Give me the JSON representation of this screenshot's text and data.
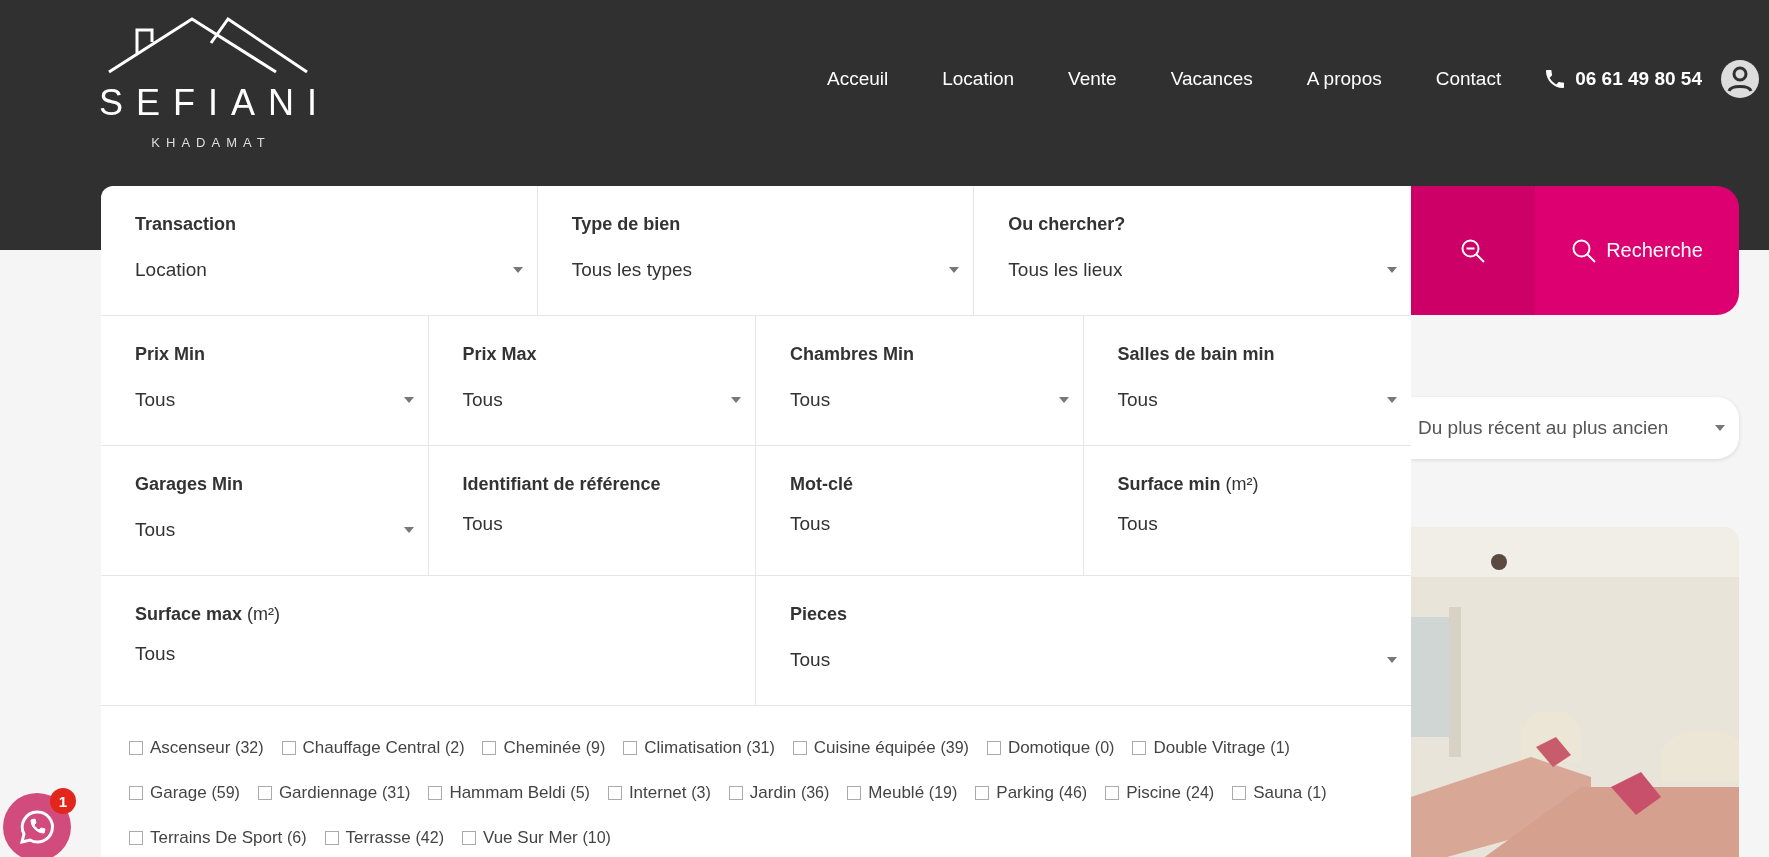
{
  "header": {
    "logo": {
      "name": "SEFIANI",
      "tagline": "KHADAMAT"
    },
    "nav": [
      {
        "label": "Acceuil"
      },
      {
        "label": "Location"
      },
      {
        "label": "Vente"
      },
      {
        "label": "Vacances"
      },
      {
        "label": "A propos"
      },
      {
        "label": "Contact"
      }
    ],
    "phone": "06 61 49 80 54"
  },
  "search": {
    "field_groups": [
      {
        "fields": [
          {
            "kind": "select",
            "label": "Transaction",
            "value": "Location"
          },
          {
            "kind": "select",
            "label": "Type de bien",
            "value": "Tous les types"
          },
          {
            "kind": "select",
            "label": "Ou chercher?",
            "value": "Tous les lieux"
          }
        ]
      },
      {
        "fields": [
          {
            "kind": "select",
            "label": "Prix Min",
            "value": "Tous"
          },
          {
            "kind": "select",
            "label": "Prix Max",
            "value": "Tous"
          },
          {
            "kind": "select",
            "label": "Chambres Min",
            "value": "Tous"
          },
          {
            "kind": "select",
            "label": "Salles de bain min",
            "value": "Tous"
          }
        ]
      },
      {
        "fields": [
          {
            "kind": "select",
            "label": "Garages Min",
            "value": "Tous"
          },
          {
            "kind": "input",
            "label": "Identifiant de référence",
            "placeholder": "Tous"
          },
          {
            "kind": "input",
            "label": "Mot-clé",
            "placeholder": "Tous"
          },
          {
            "kind": "input",
            "label": "Surface min",
            "unit": "(m²)",
            "placeholder": "Tous"
          }
        ]
      },
      {
        "fields": [
          {
            "kind": "input",
            "label": "Surface max",
            "unit": "(m²)",
            "placeholder": "Tous"
          },
          {
            "kind": "select",
            "label": "Pieces",
            "value": "Tous"
          }
        ]
      }
    ],
    "features": [
      [
        {
          "label": "Ascenseur",
          "count": "(32)",
          "checked": false
        },
        {
          "label": "Chauffage Central",
          "count": "(2)",
          "checked": false
        },
        {
          "label": "Cheminée",
          "count": "(9)",
          "checked": false
        },
        {
          "label": "Climatisation",
          "count": "(31)",
          "checked": false
        },
        {
          "label": "Cuisine équipée",
          "count": "(39)",
          "checked": false
        },
        {
          "label": "Domotique",
          "count": "(0)",
          "checked": false
        },
        {
          "label": "Double Vitrage",
          "count": "(1)",
          "checked": false
        }
      ],
      [
        {
          "label": "Garage",
          "count": "(59)",
          "checked": false
        },
        {
          "label": "Gardiennage",
          "count": "(31)",
          "checked": false
        },
        {
          "label": "Hammam Beldi",
          "count": "(5)",
          "checked": false
        },
        {
          "label": "Internet",
          "count": "(3)",
          "checked": false
        },
        {
          "label": "Jardin",
          "count": "(36)",
          "checked": false
        },
        {
          "label": "Meublé",
          "count": "(19)",
          "checked": false
        },
        {
          "label": "Parking",
          "count": "(46)",
          "checked": false
        },
        {
          "label": "Piscine",
          "count": "(24)",
          "checked": false
        },
        {
          "label": "Sauna",
          "count": "(1)",
          "checked": false
        }
      ],
      [
        {
          "label": "Terrains De Sport",
          "count": "(6)",
          "checked": false
        },
        {
          "label": "Terrasse",
          "count": "(42)",
          "checked": false
        },
        {
          "label": "Vue Sur Mer",
          "count": "(10)",
          "checked": false
        }
      ]
    ],
    "submit": "Recherche"
  },
  "sort": {
    "value": "Du plus récent au plus ancien"
  },
  "whatsapp": {
    "badge": "1"
  }
}
